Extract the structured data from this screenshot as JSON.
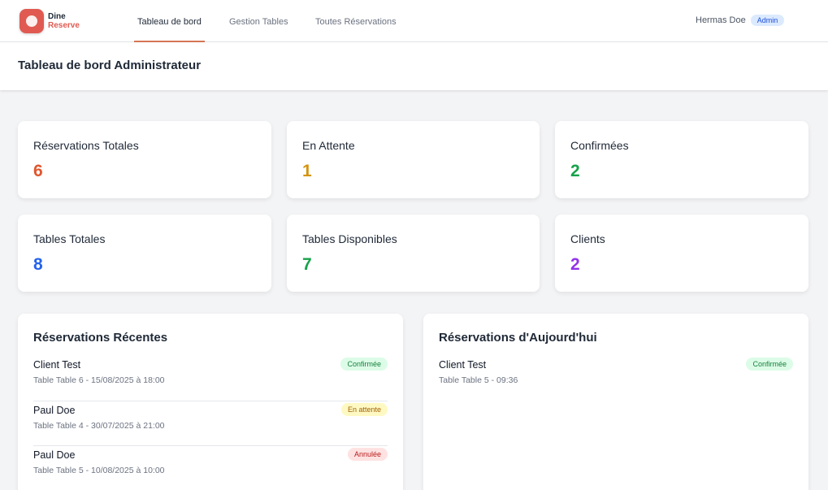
{
  "brand": {
    "line1": "Dine",
    "line2": "Reserve"
  },
  "nav": {
    "tabs": [
      "Tableau de bord",
      "Gestion Tables",
      "Toutes Réservations"
    ]
  },
  "user": {
    "name": "Hermas Doe",
    "role": "Admin"
  },
  "header": {
    "title": "Tableau de bord Administrateur"
  },
  "stats": [
    {
      "label": "Réservations Totales",
      "value": "6",
      "color": "#e0562e"
    },
    {
      "label": "En Attente",
      "value": "1",
      "color": "#d4930f"
    },
    {
      "label": "Confirmées",
      "value": "2",
      "color": "#16a34a"
    },
    {
      "label": "Tables Totales",
      "value": "8",
      "color": "#2563eb"
    },
    {
      "label": "Tables Disponibles",
      "value": "7",
      "color": "#16a34a"
    },
    {
      "label": "Clients",
      "value": "2",
      "color": "#9333ea"
    }
  ],
  "recent": {
    "title": "Réservations Récentes",
    "items": [
      {
        "name": "Client Test",
        "details": "Table Table 6 - 15/08/2025 à 18:00",
        "status": "Confirmée",
        "status_type": "confirmed"
      },
      {
        "name": "Paul Doe",
        "details": "Table Table 4 - 30/07/2025 à 21:00",
        "status": "En attente",
        "status_type": "pending"
      },
      {
        "name": "Paul Doe",
        "details": "Table Table 5 - 10/08/2025 à 10:00",
        "status": "Annulée",
        "status_type": "cancelled"
      }
    ]
  },
  "today": {
    "title": "Réservations d'Aujourd'hui",
    "items": [
      {
        "name": "Client Test",
        "details": "Table Table 5 - 09:36",
        "status": "Confirmée",
        "status_type": "confirmed"
      }
    ]
  },
  "status_colors": {
    "confirmed": {
      "bg": "#dcfce7",
      "fg": "#15803d"
    },
    "pending": {
      "bg": "#fef9c3",
      "fg": "#a16207"
    },
    "cancelled": {
      "bg": "#fee2e2",
      "fg": "#b91c1c"
    }
  }
}
